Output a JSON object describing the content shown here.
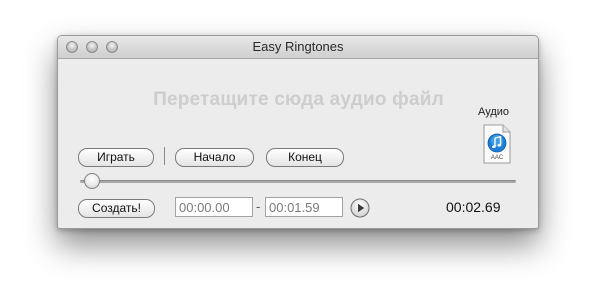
{
  "window": {
    "title": "Easy Ringtones"
  },
  "dropzone": {
    "text": "Перетащите сюда аудио файл"
  },
  "audio": {
    "label": "Аудио",
    "icon_name": "aac-file-icon",
    "badge": "AAC"
  },
  "controls": {
    "play_label": "Играть",
    "start_label": "Начало",
    "end_label": "Конец",
    "create_label": "Создать!"
  },
  "slider": {
    "position_fraction": 0.0
  },
  "range": {
    "start_value": "00:00.00",
    "separator": "-",
    "end_value": "00:01.59"
  },
  "elapsed": {
    "time": "00:02.69"
  },
  "colors": {
    "window_bg": "#ececec",
    "dropzone_text": "#cdcdcd",
    "aac_blue": "#1b7fd6"
  }
}
